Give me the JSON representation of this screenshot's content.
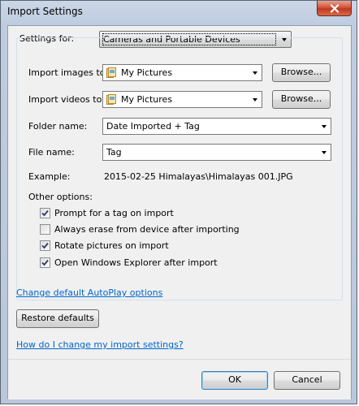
{
  "window": {
    "title": "Import Settings"
  },
  "settings_for": {
    "label": "Settings for:",
    "value": "Cameras and Portable Devices"
  },
  "import_images": {
    "label": "Import images to:",
    "value": "My Pictures",
    "browse": "Browse..."
  },
  "import_videos": {
    "label": "Import videos to:",
    "value": "My Pictures",
    "browse": "Browse..."
  },
  "folder_name": {
    "label": "Folder name:",
    "value": "Date Imported + Tag"
  },
  "file_name": {
    "label": "File name:",
    "value": "Tag"
  },
  "example": {
    "label": "Example:",
    "value": "2015-02-25 Himalayas\\Himalayas 001.JPG"
  },
  "other_options": {
    "label": "Other options:",
    "items": [
      {
        "label": "Prompt for a tag on import",
        "checked": true
      },
      {
        "label": "Always erase from device after importing",
        "checked": false
      },
      {
        "label": "Rotate pictures on import",
        "checked": true
      },
      {
        "label": "Open Windows Explorer after import",
        "checked": true
      }
    ]
  },
  "links": {
    "autoplay": "Change default AutoPlay options",
    "help": "How do I change my import settings?"
  },
  "buttons": {
    "restore": "Restore defaults",
    "ok": "OK",
    "cancel": "Cancel"
  },
  "colors": {
    "link": "#0066cc",
    "close_button": "#c0391f",
    "frame": "#bfcce0"
  }
}
